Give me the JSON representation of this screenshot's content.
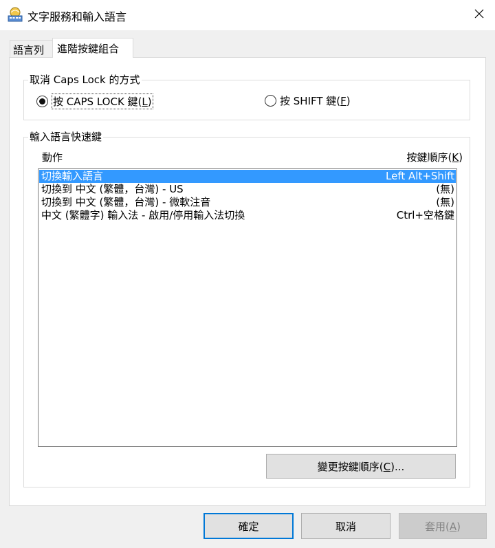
{
  "window": {
    "title": "文字服務和輸入語言",
    "icon": "keyboard-globe-icon",
    "close_icon": "close-icon"
  },
  "tabs": [
    {
      "label": "語言列"
    },
    {
      "label": "進階按鍵組合"
    }
  ],
  "caps_group": {
    "caption": "取消 Caps Lock 的方式",
    "options": [
      {
        "prefix": "按 CAPS LOCK 鍵(",
        "mnemonic": "L",
        "suffix": ")",
        "selected": true
      },
      {
        "prefix": "按 SHIFT 鍵(",
        "mnemonic": "F",
        "suffix": ")",
        "selected": false
      }
    ]
  },
  "hotkey_group": {
    "caption": "輸入語言快速鍵",
    "col_action": "動作",
    "col_seq_prefix": "按鍵順序(",
    "col_seq_mnemonic": "K",
    "col_seq_suffix": ")",
    "rows": [
      {
        "action": "切換輸入語言",
        "keys": "Left Alt+Shift",
        "selected": true
      },
      {
        "action": "切換到 中文 (繁體，台灣) - US",
        "keys": "(無)",
        "selected": false
      },
      {
        "action": "切換到 中文 (繁體，台灣) - 微軟注音",
        "keys": "(無)",
        "selected": false
      },
      {
        "action": "中文 (繁體字) 輸入法 - 啟用/停用輸入法切換",
        "keys": "Ctrl+空格鍵",
        "selected": false
      }
    ],
    "change_button": {
      "prefix": "變更按鍵順序(",
      "mnemonic": "C",
      "suffix": ")..."
    }
  },
  "footer": {
    "ok": "確定",
    "cancel": "取消",
    "apply_prefix": "套用(",
    "apply_mnemonic": "A",
    "apply_suffix": ")"
  },
  "colors": {
    "selection": "#3399ff",
    "default_button_border": "#0078d7"
  }
}
